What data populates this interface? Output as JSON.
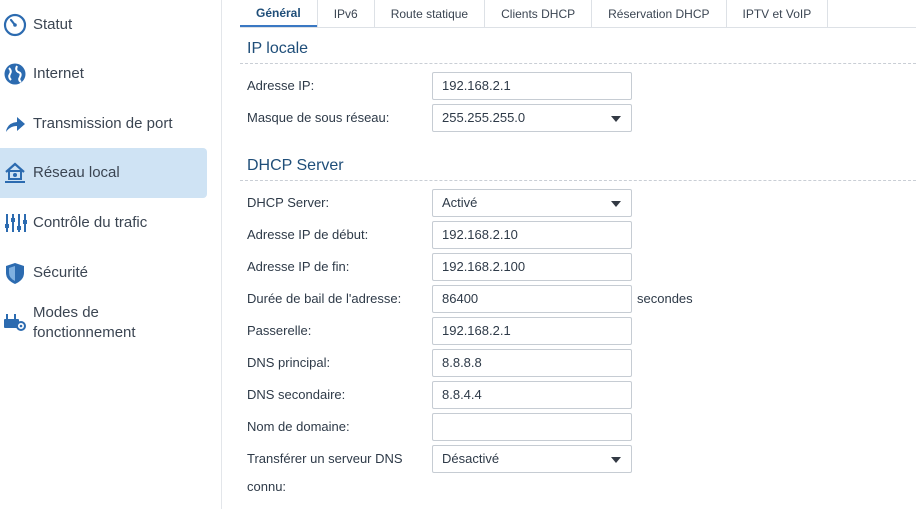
{
  "sidebar": {
    "items": [
      {
        "label": "Statut",
        "icon": "speedometer-icon"
      },
      {
        "label": "Internet",
        "icon": "globe-icon"
      },
      {
        "label": "Transmission de port",
        "icon": "forward-arrow-icon"
      },
      {
        "label": "Réseau local",
        "icon": "home-network-icon",
        "active": true
      },
      {
        "label": "Contrôle du trafic",
        "icon": "sliders-icon"
      },
      {
        "label": "Sécurité",
        "icon": "shield-icon"
      },
      {
        "label_line1": "Modes de",
        "label_line2": "fonctionnement",
        "icon": "router-gear-icon"
      }
    ]
  },
  "tabs": [
    {
      "label": "Général",
      "active": true
    },
    {
      "label": "IPv6"
    },
    {
      "label": "Route statique"
    },
    {
      "label": "Clients DHCP"
    },
    {
      "label": "Réservation DHCP"
    },
    {
      "label": "IPTV et VoIP"
    }
  ],
  "ip_section": {
    "title": "IP locale",
    "ip_label": "Adresse IP:",
    "ip_value": "192.168.2.1",
    "mask_label": "Masque de sous réseau:",
    "mask_value": "255.255.255.0"
  },
  "dhcp_section": {
    "title": "DHCP Server",
    "server_label": "DHCP Server:",
    "server_value": "Activé",
    "start_label": "Adresse IP de début:",
    "start_value": "192.168.2.10",
    "end_label": "Adresse IP de fin:",
    "end_value": "192.168.2.100",
    "lease_label": "Durée de bail de l'adresse:",
    "lease_value": "86400",
    "lease_unit": "secondes",
    "gateway_label": "Passerelle:",
    "gateway_value": "192.168.2.1",
    "dns1_label": "DNS principal:",
    "dns1_value": "8.8.8.8",
    "dns2_label": "DNS secondaire:",
    "dns2_value": "8.8.4.4",
    "domain_label": "Nom de domaine:",
    "domain_value": "",
    "forward_label_line1": "Transférer un serveur DNS",
    "forward_label_line2": "connu:",
    "forward_value": "Désactivé"
  },
  "colors": {
    "accent": "#3a78c3",
    "active_bg": "#cfe3f4",
    "title": "#1f4e79"
  }
}
